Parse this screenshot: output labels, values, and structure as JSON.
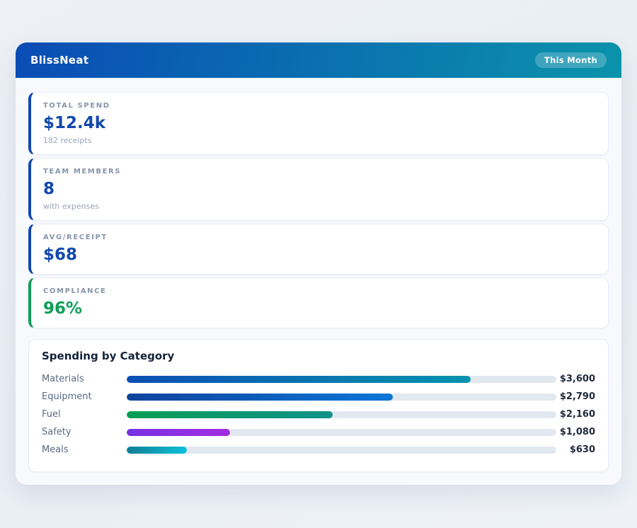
{
  "app": {
    "title": "BlissNeat",
    "period_badge": "This Month"
  },
  "colors": {
    "header_gradient_from": "#0a4cb5",
    "header_gradient_to": "#0b93ab",
    "accent_blue": "#1347ad",
    "accent_green": "#0d9e57",
    "bar_track": "#e2e8f0",
    "page_background": "#edf0f6"
  },
  "stats": [
    {
      "label": "TOTAL SPEND",
      "value": "$12.4k",
      "sub": "182 receipts",
      "accent": "#1347ad",
      "value_color": "#1148ae"
    },
    {
      "label": "TEAM MEMBERS",
      "value": "8",
      "sub": "with expenses",
      "accent": "#1347ad",
      "value_color": "#1148ae"
    },
    {
      "label": "AVG/RECEIPT",
      "value": "$68",
      "sub": "",
      "accent": "#1347ad",
      "value_color": "#1148ae"
    },
    {
      "label": "COMPLIANCE",
      "value": "96%",
      "sub": "",
      "accent": "#0d9e57",
      "value_color": "#0d9e57"
    }
  ],
  "chart_data": {
    "type": "bar",
    "orientation": "horizontal",
    "title": "Spending by Category",
    "categories": [
      "Materials",
      "Equipment",
      "Fuel",
      "Safety",
      "Meals"
    ],
    "values": [
      3600,
      2790,
      2160,
      1080,
      630
    ],
    "value_labels": [
      "$3,600",
      "$2,790",
      "$2,160",
      "$1,080",
      "$630"
    ],
    "xlim": [
      0,
      4500
    ],
    "grid": false,
    "legend": false,
    "bar_colors": [
      [
        "#0b4fb3",
        "#0993ad"
      ],
      [
        "#11439c",
        "#0b76d8"
      ],
      [
        "#069e54",
        "#12918a"
      ],
      [
        "#7632e2",
        "#a32ce2"
      ],
      [
        "#107e96",
        "#0cc0da"
      ]
    ]
  }
}
